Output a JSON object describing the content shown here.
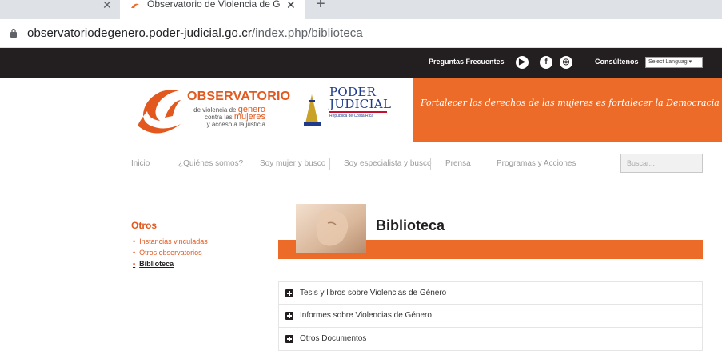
{
  "browser": {
    "tab_title": "Observatorio de Violencia de Gé",
    "tab_close_icon": "close-icon",
    "new_tab_icon": "plus-icon",
    "url_host": "observatoriodegenero.poder-judicial.go.cr",
    "url_path": "/index.php/biblioteca"
  },
  "topbar": {
    "faq_label": "Preguntas Frecuentes",
    "social": [
      "youtube-icon",
      "facebook-icon",
      "instagram-icon"
    ],
    "consult_label": "Consúltenos",
    "language_select": "Select Languag"
  },
  "header": {
    "obs_title": "OBSERVATORIO",
    "obs_line1": "de violencia de",
    "obs_genero": "género",
    "obs_line2": "contra las",
    "obs_mujeres": "mujeres",
    "obs_line3": "y acceso a la justicia",
    "pj_line1": "PODER",
    "pj_line2": "JUDICIAL",
    "pj_sub": "República de Costa Rica",
    "motto": "Fortalecer los derechos de las mujeres es fortalecer la Democracia",
    "accent": "#ed6b28"
  },
  "nav": {
    "items": [
      "Inicio",
      "¿Quiénes somos?",
      "Soy mujer y busco",
      "Soy especialista y busco",
      "Prensa",
      "Programas y Acciones"
    ],
    "search_placeholder": "Buscar..."
  },
  "sidebar": {
    "title": "Otros",
    "items": [
      "Instancias vinculadas",
      "Otros observatorios",
      "Biblioteca"
    ]
  },
  "main": {
    "title": "Biblioteca",
    "accordion": [
      "Tesis y libros sobre Violencias de Género",
      "Informes sobre Violencias de Género",
      "Otros Documentos"
    ]
  }
}
